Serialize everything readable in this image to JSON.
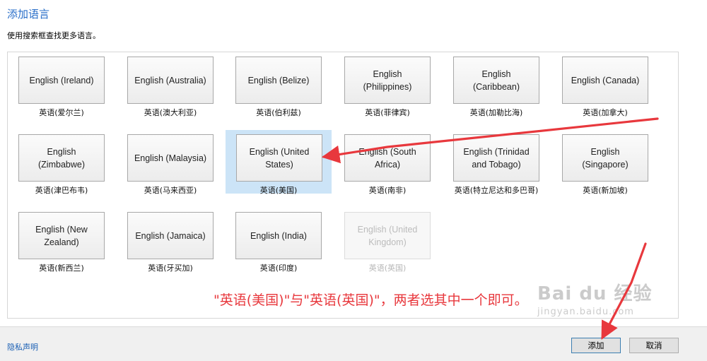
{
  "dialog": {
    "title": "添加语言",
    "subtitle": "使用搜索框查找更多语言。"
  },
  "languages": [
    {
      "name": "English (Ireland)",
      "native": "英语(爱尔兰)",
      "state": "normal"
    },
    {
      "name": "English (Australia)",
      "native": "英语(澳大利亚)",
      "state": "normal"
    },
    {
      "name": "English (Belize)",
      "native": "英语(伯利兹)",
      "state": "normal"
    },
    {
      "name": "English (Philippines)",
      "native": "英语(菲律宾)",
      "state": "normal"
    },
    {
      "name": "English (Caribbean)",
      "native": "英语(加勒比海)",
      "state": "normal"
    },
    {
      "name": "English (Canada)",
      "native": "英语(加拿大)",
      "state": "normal"
    },
    {
      "name": "English (Zimbabwe)",
      "native": "英语(津巴布韦)",
      "state": "normal"
    },
    {
      "name": "English (Malaysia)",
      "native": "英语(马来西亚)",
      "state": "normal"
    },
    {
      "name": "English (United States)",
      "native": "英语(美国)",
      "state": "selected"
    },
    {
      "name": "English (South Africa)",
      "native": "英语(南非)",
      "state": "normal"
    },
    {
      "name": "English (Trinidad and Tobago)",
      "native": "英语(特立尼达和多巴哥)",
      "state": "normal"
    },
    {
      "name": "English (Singapore)",
      "native": "英语(新加坡)",
      "state": "normal"
    },
    {
      "name": "English (New Zealand)",
      "native": "英语(新西兰)",
      "state": "normal"
    },
    {
      "name": "English (Jamaica)",
      "native": "英语(牙买加)",
      "state": "normal"
    },
    {
      "name": "English (India)",
      "native": "英语(印度)",
      "state": "normal"
    },
    {
      "name": "English (United Kingdom)",
      "native": "英语(英国)",
      "state": "disabled"
    }
  ],
  "footer": {
    "privacy_link": "隐私声明",
    "add_label": "添加",
    "cancel_label": "取消"
  },
  "annotation": {
    "text": "\"英语(美国)\"与\"英语(英国)\"，两者选其中一个即可。",
    "color": "#e8383d"
  },
  "watermark": {
    "main": "Bai du 经验",
    "sub": "jingyan.baidu.com"
  },
  "colors": {
    "accent": "#2a6fc9",
    "selection": "#cce4f7"
  }
}
